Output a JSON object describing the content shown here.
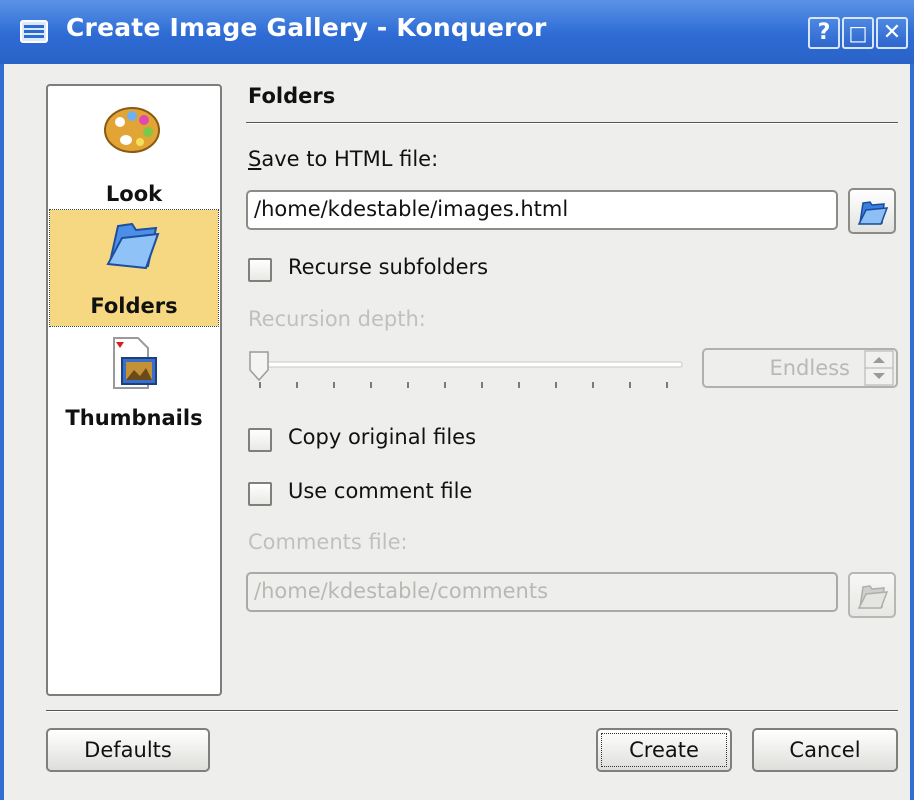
{
  "window": {
    "title": "Create Image Gallery - Konqueror",
    "controls": [
      "?",
      "□",
      "✕"
    ]
  },
  "sidebar": {
    "items": [
      {
        "label": "Look",
        "icon": "palette-icon",
        "active": false
      },
      {
        "label": "Folders",
        "icon": "folder-icon",
        "active": true
      },
      {
        "label": "Thumbnails",
        "icon": "thumbnails-icon",
        "active": false
      }
    ]
  },
  "folders": {
    "heading": "Folders",
    "save_label_prefix": "S",
    "save_label_rest": "ave to HTML file:",
    "save_path": "/home/kdestable/images.html",
    "recurse_label": "Recurse subfolders",
    "recurse_checked": false,
    "recursion_depth_label": "Recursion depth:",
    "recursion_depth_value": "Endless",
    "copy_label": "Copy original files",
    "copy_checked": false,
    "use_comment_label": "Use comment file",
    "use_comment_checked": false,
    "comments_file_label": "Comments file:",
    "comments_path": "/home/kdestable/comments"
  },
  "buttons": {
    "defaults": "Defaults",
    "create": "Create",
    "cancel": "Cancel"
  },
  "colors": {
    "titlebar": "#2d6bd4",
    "selection": "#f7d882",
    "window_bg": "#eeeeec",
    "disabled_text": "#c0c0bc"
  }
}
